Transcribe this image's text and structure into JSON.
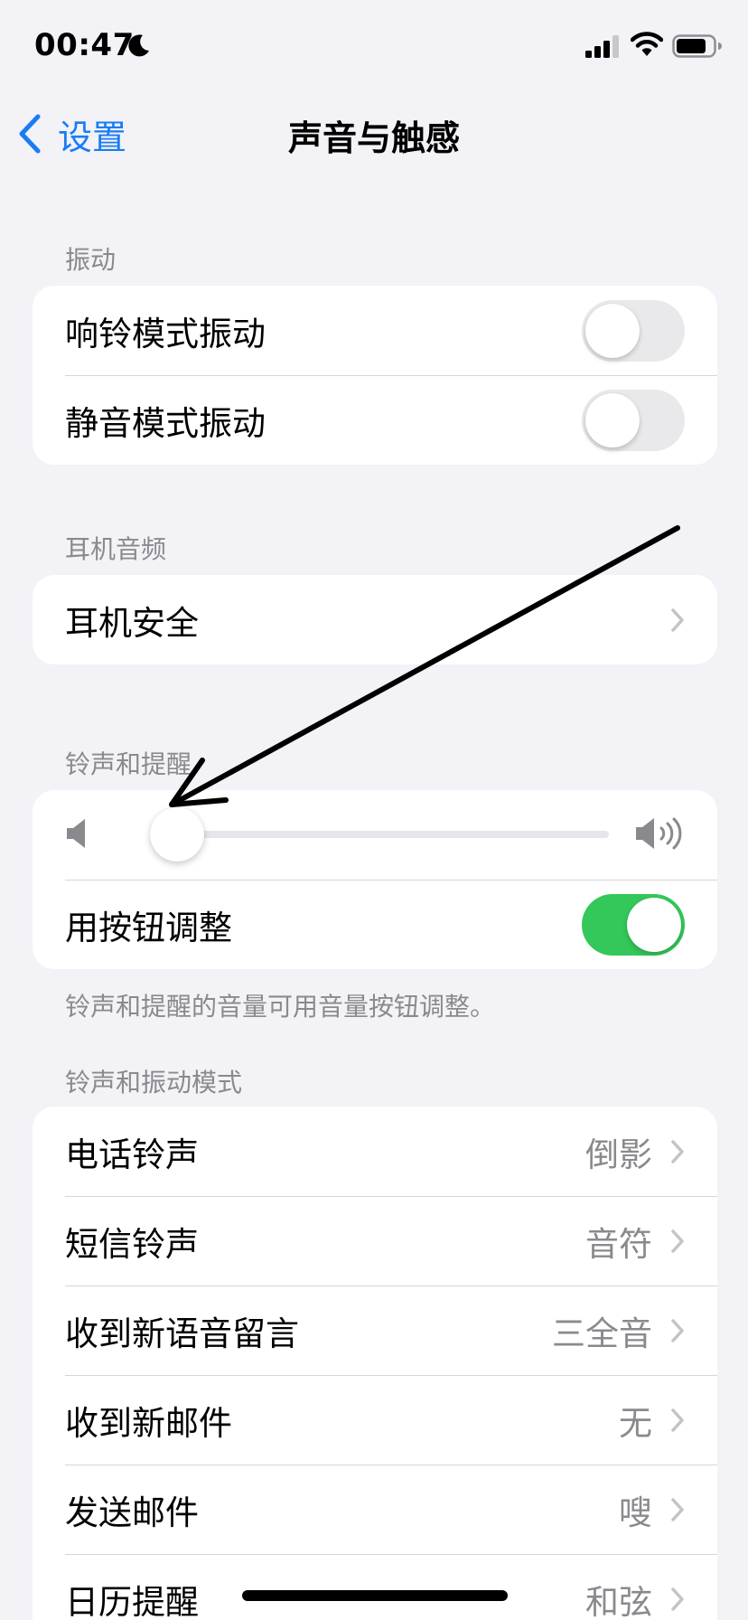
{
  "status_bar": {
    "time": "00:47"
  },
  "nav": {
    "back_label": "设置",
    "title": "声音与触感"
  },
  "vibration": {
    "header": "振动",
    "rows": [
      {
        "label": "响铃模式振动",
        "on": false
      },
      {
        "label": "静音模式振动",
        "on": false
      }
    ]
  },
  "headphone_audio": {
    "header": "耳机音频",
    "rows": [
      {
        "label": "耳机安全"
      }
    ]
  },
  "ringer_alerts": {
    "header": "铃声和提醒",
    "volume_level": 0.0,
    "change_with_buttons_label": "用按钮调整",
    "change_with_buttons_on": true,
    "footer": "铃声和提醒的音量可用音量按钮调整。"
  },
  "sounds_patterns": {
    "header": "铃声和振动模式",
    "rows": [
      {
        "label": "电话铃声",
        "value": "倒影"
      },
      {
        "label": "短信铃声",
        "value": "音符"
      },
      {
        "label": "收到新语音留言",
        "value": "三全音"
      },
      {
        "label": "收到新邮件",
        "value": "无"
      },
      {
        "label": "发送邮件",
        "value": "嗖"
      },
      {
        "label": "日历提醒",
        "value": "和弦"
      }
    ]
  },
  "colors": {
    "accent": "#1a7cf5",
    "toggle_on": "#34c759",
    "background": "#f2f2f7",
    "secondary_text": "#8a8a8e"
  }
}
